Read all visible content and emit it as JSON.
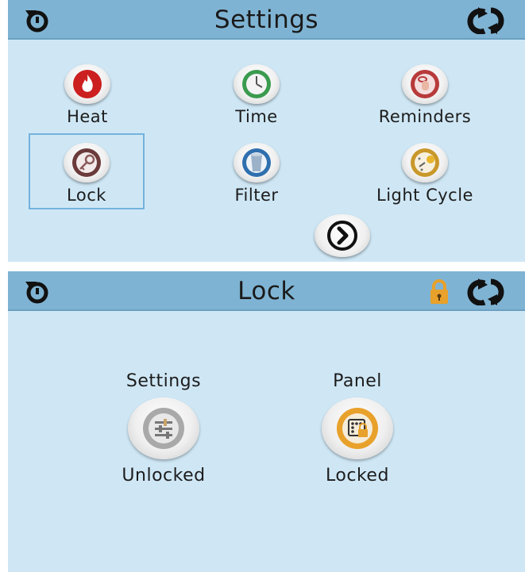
{
  "settings_screen": {
    "title": "Settings",
    "back_icon": "back-arrow-icon",
    "refresh_icon": "refresh-icon",
    "tiles": [
      {
        "label": "Heat",
        "icon": "flame-icon",
        "color": "#cc1f1f"
      },
      {
        "label": "Time",
        "icon": "clock-icon",
        "color": "#3a9b4e"
      },
      {
        "label": "Reminders",
        "icon": "reminder-hand-icon",
        "color": "#b83a3a"
      },
      {
        "label": "Lock",
        "icon": "key-icon",
        "color": "#6b3a3a"
      },
      {
        "label": "Filter",
        "icon": "filter-icon",
        "color": "#2f6fae"
      },
      {
        "label": "Light Cycle",
        "icon": "light-cycle-icon",
        "color": "#c9982a"
      }
    ],
    "selected_tile": "Lock",
    "next_icon": "chevron-right-icon"
  },
  "lock_screen": {
    "title": "Lock",
    "padlock_icon": "padlock-icon",
    "settings": {
      "label": "Settings",
      "state": "Unlocked",
      "icon": "settings-sliders-icon"
    },
    "panel": {
      "label": "Panel",
      "state": "Locked",
      "icon": "keypad-lock-icon"
    }
  },
  "colors": {
    "screen_bg": "#cfe7f5",
    "bar_bg": "#7fb3d3",
    "selection": "#74b3dd",
    "lock_accent": "#e8a12a"
  }
}
